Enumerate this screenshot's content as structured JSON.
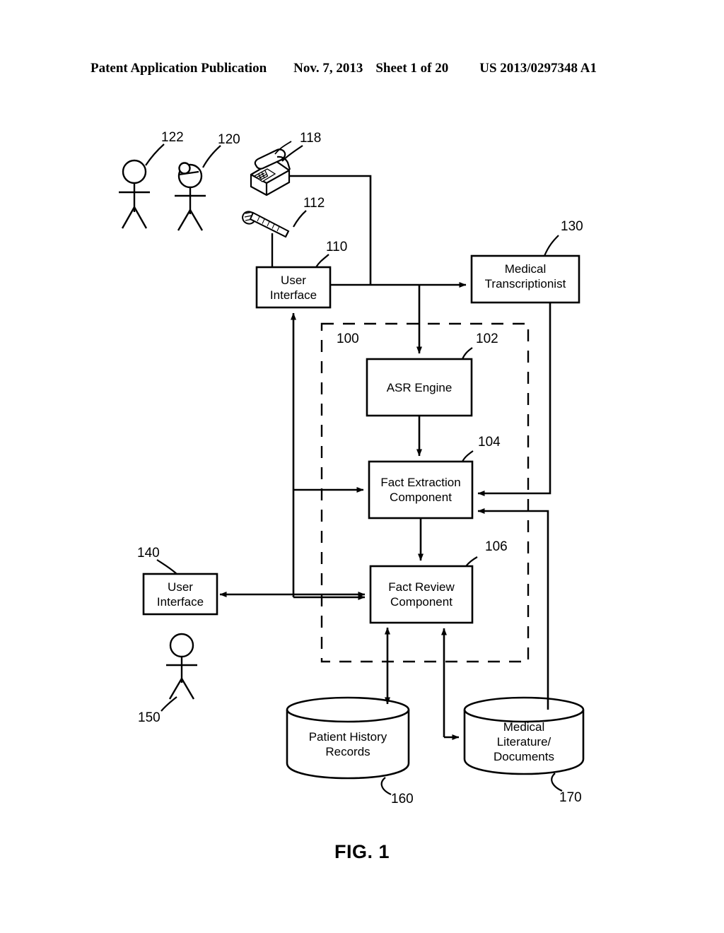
{
  "header": {
    "publication": "Patent Application Publication",
    "date": "Nov. 7, 2013",
    "sheet": "Sheet 1 of 20",
    "patent_number": "US 2013/0297348 A1"
  },
  "figure": {
    "caption": "FIG. 1",
    "nodes": {
      "user_interface_top": "User Interface",
      "user_interface_top_line1": "User",
      "user_interface_top_line2": "Interface",
      "medical_transcriptionist_line1": "Medical",
      "medical_transcriptionist_line2": "Transcriptionist",
      "asr_engine": "ASR Engine",
      "fact_extraction_line1": "Fact Extraction",
      "fact_extraction_line2": "Component",
      "fact_review_line1": "Fact Review",
      "fact_review_line2": "Component",
      "user_interface_bottom_line1": "User",
      "user_interface_bottom_line2": "Interface",
      "patient_history_line1": "Patient History",
      "patient_history_line2": "Records",
      "medical_literature_line1": "Medical",
      "medical_literature_line2": "Literature/",
      "medical_literature_line3": "Documents"
    },
    "reference_numerals": {
      "patient": "122",
      "clinician": "120",
      "telephone": "118",
      "microphone": "112",
      "user_interface_top": "110",
      "medical_transcriptionist": "130",
      "system_boundary": "100",
      "asr_engine": "102",
      "fact_extraction": "104",
      "fact_review": "106",
      "user_interface_bottom": "140",
      "reviewer": "150",
      "patient_history": "160",
      "medical_literature": "170"
    }
  },
  "colors": {
    "ink": "#000000",
    "paper": "#ffffff"
  }
}
